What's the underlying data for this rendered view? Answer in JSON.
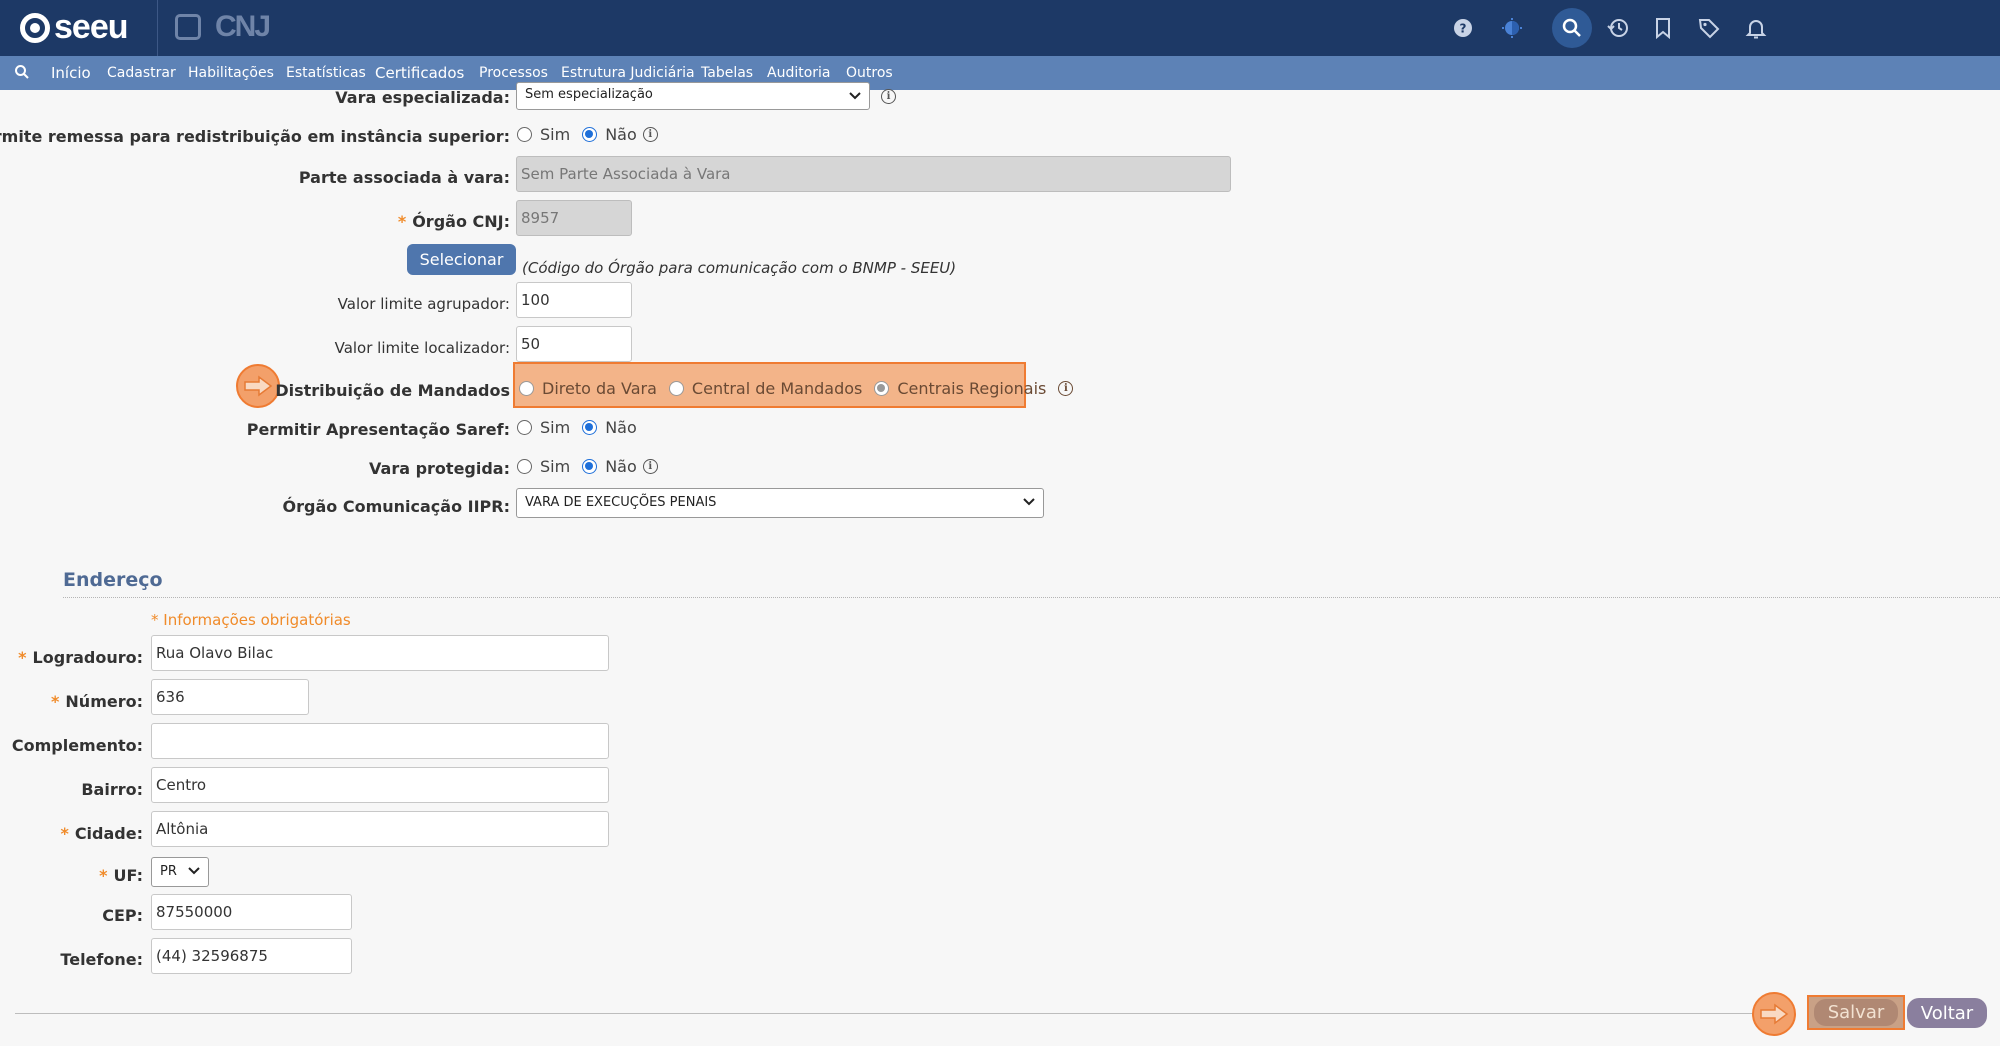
{
  "header": {
    "logo_text": "seeu",
    "cnj_text": "CNJ",
    "icons": [
      "help-icon",
      "theme-icon",
      "search-icon",
      "history-icon",
      "bookmark-icon",
      "tag-icon",
      "bell-icon"
    ]
  },
  "nav": {
    "items": [
      "Início",
      "Cadastrar",
      "Habilitações",
      "Estatísticas",
      "Certificados",
      "Processos",
      "Estrutura Judiciária",
      "Tabelas",
      "Auditoria",
      "Outros"
    ]
  },
  "form": {
    "vara_especializada": {
      "label": "Vara especializada:",
      "value": "Sem especialização"
    },
    "permite_remessa": {
      "label": "Permite remessa para redistribuição em instância superior:",
      "options": [
        "Sim",
        "Não"
      ],
      "selected": "Não"
    },
    "parte_associada": {
      "label": "Parte associada à vara:",
      "placeholder": "Sem Parte Associada à Vara"
    },
    "orgao_cnj": {
      "label": "Órgão CNJ:",
      "value": "8957",
      "required_mark": "*"
    },
    "selecionar_button": "Selecionar",
    "orgao_hint": "(Código do Órgão para comunicação com o BNMP - SEEU)",
    "valor_limite_agrupador": {
      "label": "Valor limite agrupador:",
      "value": "100"
    },
    "valor_limite_localizador": {
      "label": "Valor limite localizador:",
      "value": "50"
    },
    "distribuicao_mandados": {
      "label": "Distribuição de Mandados",
      "options": [
        "Direto da Vara",
        "Central de Mandados",
        "Centrais Regionais"
      ],
      "selected": "Centrais Regionais"
    },
    "permitir_saref": {
      "label": "Permitir Apresentação Saref:",
      "options": [
        "Sim",
        "Não"
      ],
      "selected": "Não"
    },
    "vara_protegida": {
      "label": "Vara protegida:",
      "options": [
        "Sim",
        "Não"
      ],
      "selected": "Não"
    },
    "orgao_iipr": {
      "label": "Órgão Comunicação IIPR:",
      "value": "VARA DE EXECUÇÕES PENAIS"
    }
  },
  "endereco": {
    "title": "Endereço",
    "required_note": "* Informações obrigatórias",
    "logradouro": {
      "label": "Logradouro:",
      "value": "Rua Olavo Bilac"
    },
    "numero": {
      "label": "Número:",
      "value": "636"
    },
    "complemento": {
      "label": "Complemento:",
      "value": ""
    },
    "bairro": {
      "label": "Bairro:",
      "value": "Centro"
    },
    "cidade": {
      "label": "Cidade:",
      "value": "Altônia"
    },
    "uf": {
      "label": "UF:",
      "value": "PR"
    },
    "cep": {
      "label": "CEP:",
      "value": "87550000"
    },
    "telefone": {
      "label": "Telefone:",
      "value": "(44) 32596875"
    }
  },
  "actions": {
    "save": "Salvar",
    "back": "Voltar"
  },
  "colors": {
    "topbar": "#1d3966",
    "navbar": "#5d82b6",
    "highlight": "#ef7b32",
    "required": "#f08b2a"
  }
}
